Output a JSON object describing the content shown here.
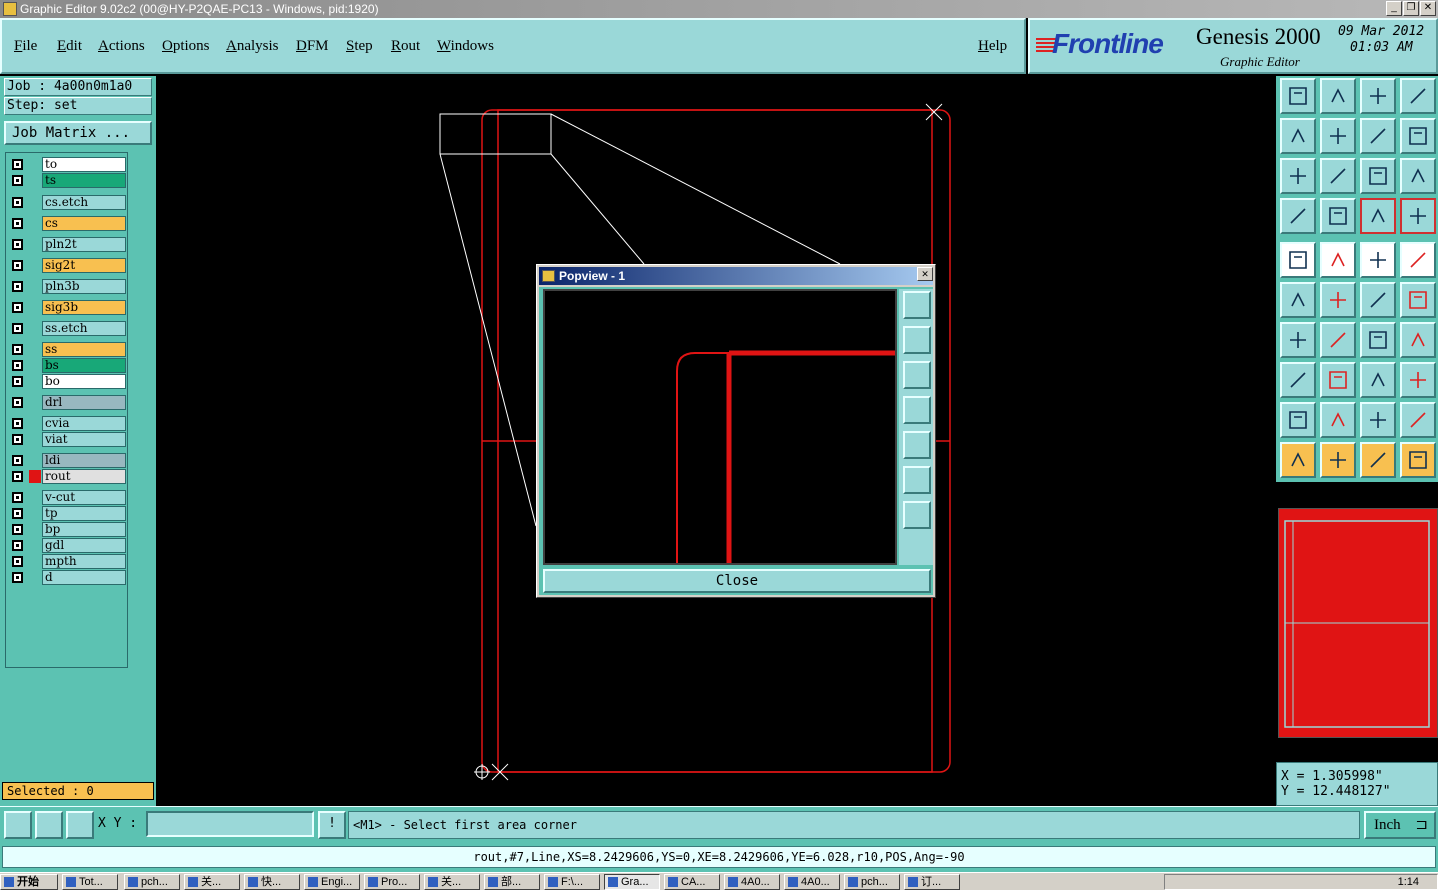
{
  "window": {
    "title": "Graphic Editor 9.02c2 (00@HY-P2QAE-PC13 - Windows, pid:1920)"
  },
  "menu": {
    "items": [
      "File",
      "Edit",
      "Actions",
      "Options",
      "Analysis",
      "DFM",
      "Step",
      "Rout",
      "Windows"
    ],
    "help": "Help"
  },
  "brand": {
    "logo": "Frontline",
    "product": "Genesis 2000",
    "subtitle": "Graphic Editor",
    "date": "09 Mar 2012",
    "time": "01:03 AM"
  },
  "job": {
    "job_label": "Job : 4a00n0m1a0",
    "step_label": "Step: set",
    "matrix_button": "Job Matrix ..."
  },
  "layers": [
    {
      "name": "to",
      "color": "#ffffff"
    },
    {
      "name": "ts",
      "color": "#18a878"
    },
    {
      "name": "cs.etch",
      "color": "#9ad8d8"
    },
    {
      "name": "cs",
      "color": "#f8c050"
    },
    {
      "name": "pln2t",
      "color": "#9ad8d8"
    },
    {
      "name": "sig2t",
      "color": "#f8c050"
    },
    {
      "name": "pln3b",
      "color": "#9ad8d8"
    },
    {
      "name": "sig3b",
      "color": "#f8c050"
    },
    {
      "name": "ss.etch",
      "color": "#9ad8d8"
    },
    {
      "name": "ss",
      "color": "#f8c050"
    },
    {
      "name": "bs",
      "color": "#18a878"
    },
    {
      "name": "bo",
      "color": "#ffffff"
    },
    {
      "name": "drl",
      "color": "#98b8c0"
    },
    {
      "name": "cvia",
      "color": "#9ad8d8"
    },
    {
      "name": "viat",
      "color": "#9ad8d8"
    },
    {
      "name": "ldi",
      "color": "#98b8c0"
    },
    {
      "name": "rout",
      "color": "#e0e0e0"
    },
    {
      "name": "v-cut",
      "color": "#9ad8d8"
    },
    {
      "name": "tp",
      "color": "#9ad8d8"
    },
    {
      "name": "bp",
      "color": "#9ad8d8"
    },
    {
      "name": "gdl",
      "color": "#9ad8d8"
    },
    {
      "name": "mpth",
      "color": "#9ad8d8"
    },
    {
      "name": "d",
      "color": "#9ad8d8"
    }
  ],
  "selected": "Selected : 0",
  "popview": {
    "title": "Popview - 1",
    "close_label": "Close"
  },
  "coords": {
    "x": "X = 1.305998\"",
    "y": "Y = 12.448127\""
  },
  "command": {
    "xy_label": "X Y :",
    "xy_value": "",
    "prompt": "<M1> - Select first area corner",
    "units": "Inch"
  },
  "status": "rout,#7,Line,XS=8.2429606,YS=0,XE=8.2429606,YE=6.028,r10,POS,Ang=-90",
  "taskbar": {
    "start": "开始",
    "tasks": [
      "Tot...",
      "pch...",
      "关...",
      "快...",
      "Engi...",
      "Pro...",
      "关...",
      "部...",
      "F:\\...",
      "Gra...",
      "CA...",
      "4A0...",
      "4A0...",
      "pch...",
      "订..."
    ],
    "clock": "1:14"
  },
  "colors": {
    "rout": "#e01414",
    "panel": "#5cc2b2",
    "button": "#9ad8d8"
  }
}
